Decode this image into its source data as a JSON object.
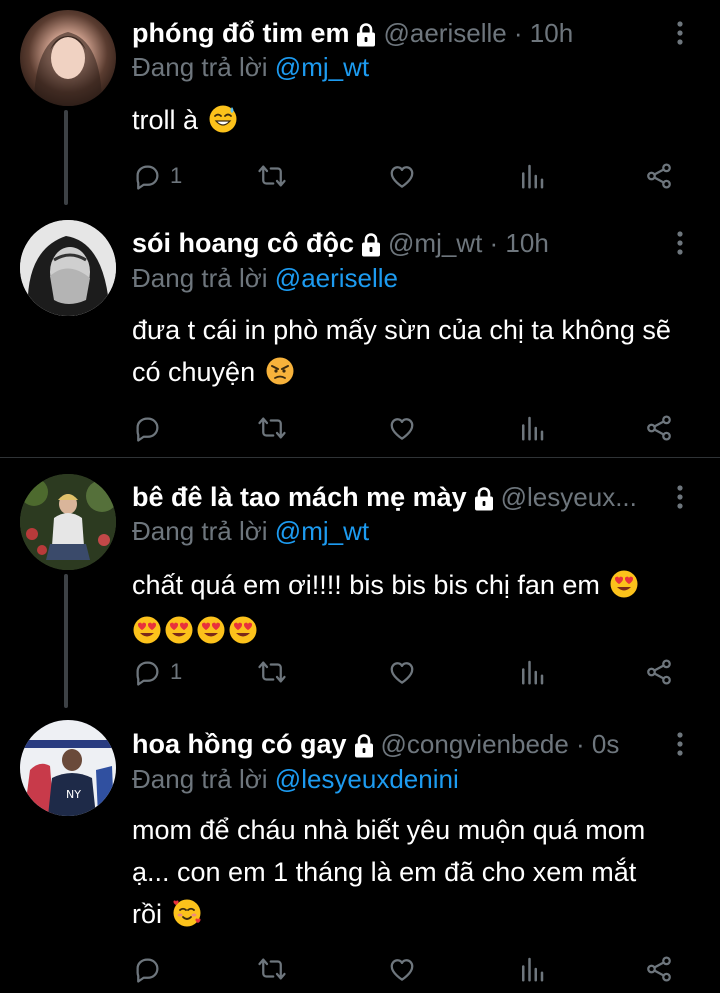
{
  "tweets": [
    {
      "name": "phóng đổ tim em",
      "meta": "@aeriselle · 10h",
      "replying_prefix": "Đang trả lời",
      "replying_to": "@mj_wt",
      "text_1": "troll à",
      "reply_count": "1"
    },
    {
      "name": "sói hoang cô độc",
      "meta": "@mj_wt · 10h",
      "replying_prefix": "Đang trả lời",
      "replying_to": "@aeriselle",
      "text_1": "đưa t cái in phò mấy sừn của chị ta không sẽ",
      "text_2": "có chuyện",
      "reply_count": ""
    },
    {
      "name": "bê đê là tao mách mẹ mày",
      "meta": "@lesyeux...",
      "replying_prefix": "Đang trả lời",
      "replying_to": "@mj_wt",
      "text_1": "chất quá em ơi!!!! bis bis bis chị fan em",
      "reply_count": "1"
    },
    {
      "name": "hoa hồng có gay",
      "meta": "@congvienbede · 0s",
      "replying_prefix": "Đang trả lời",
      "replying_to": "@lesyeuxdenini",
      "text_1": "mom để cháu nhà biết yêu muộn quá mom",
      "text_2": "ạ... con em 1 tháng là em đã cho xem mắt",
      "text_3": "rồi",
      "reply_count": ""
    }
  ],
  "icons": {
    "reply": "comment-icon",
    "retweet": "retweet-icon",
    "like": "heart-icon",
    "views": "analytics-icon",
    "share": "share-icon",
    "more": "more-vertical-icon",
    "lock": "lock-icon"
  },
  "colors": {
    "background": "#000000",
    "text": "#ffffff",
    "muted": "#6e767d",
    "link": "#1d9bf0",
    "divider": "#2f3336"
  }
}
